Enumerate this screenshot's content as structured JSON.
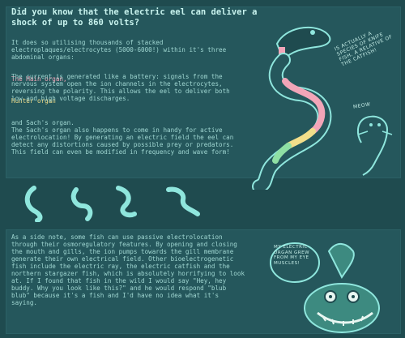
{
  "title": "Did you know that the electric eel can deliver a shock of up to 860 volts?",
  "intro": "It does so utilising thousands of stacked electroplaques/electrocytes (5000-6000!) within it's three abdominal organs:",
  "organs": {
    "main": "The Main organ,",
    "hunter": "Hunter organ",
    "sach": "and Sach's organ."
  },
  "para2": "The current is generated like a battery: signals from the nervous system open the ion channels in the electrocytes, reversing the polarity. This allows the eel to deliver both low and high voltage discharges.",
  "para3": "The Sach's organ also happens to come in handy for active electrolocation! By generating an electric field the eel can detect any distortions caused by possible prey or predators. This field can even be modified in frequency and wave form!",
  "para4": "As a side note, some fish can use passive electrolocation through their osmoregulatory features. By opening and closing the mouth and gills, the ion pumps towards the gill membrane generate their own electrical field. Other bioelectrogenetic fish include the electric ray, the electric catfish and the northern stargazer fish, which is absolutely horrifying to look at. If I found that fish in the wild I would say \"Hey, hey buddy. Why you look like this?\" and he would respond \"blub blub\" because it's a fish and I'd have no idea what it's saying.",
  "annotations": {
    "knifefish": "IS ACTUALLY A SPECIES OF KNIFE FISH, A RELATIVE OF THE CATFISH!",
    "meow": "MEOW",
    "stargazer": "MY ELECTRIC ORGAN GREW FROM MY EYE MUSCLES!"
  },
  "colors": {
    "background": "#1f4b4f",
    "panel": "#25575c",
    "main_organ": "#f2a5b8",
    "hunter_organ": "#f2de8a",
    "sach_organ": "#8fe0a4",
    "line_art": "#8fe6dd"
  }
}
